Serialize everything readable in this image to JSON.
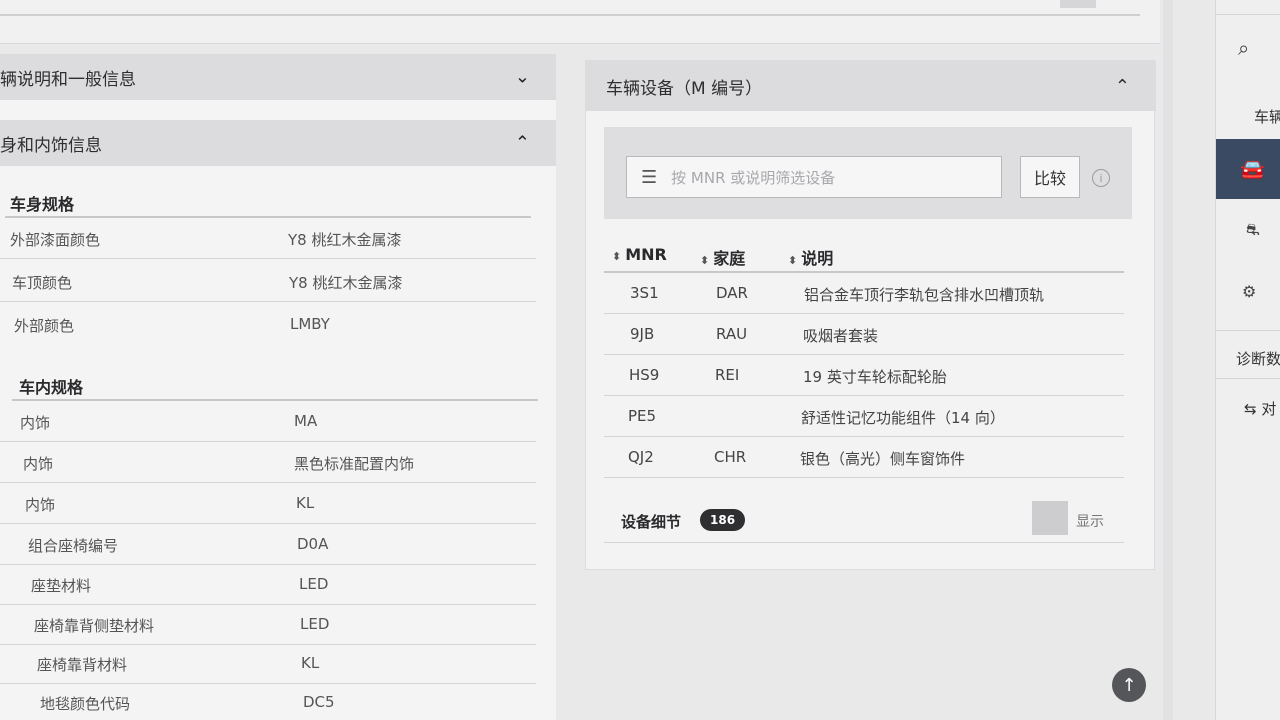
{
  "left": {
    "acc1_title": "辆说明和一般信息",
    "acc2_title": "身和内饰信息",
    "body_spec_title": "车身规格",
    "body_rows": [
      {
        "k": "外部漆面颜色",
        "v": "Y8 桃红木金属漆"
      },
      {
        "k": "车顶颜色",
        "v": "Y8 桃红木金属漆"
      },
      {
        "k": "外部颜色",
        "v": "LMBY"
      }
    ],
    "interior_spec_title": "车内规格",
    "interior_rows": [
      {
        "k": "内饰",
        "v": "MA"
      },
      {
        "k": "内饰",
        "v": "黑色标准配置内饰"
      },
      {
        "k": "内饰",
        "v": "KL"
      },
      {
        "k": "组合座椅编号",
        "v": "D0A"
      },
      {
        "k": "座垫材料",
        "v": "LED"
      },
      {
        "k": "座椅靠背侧垫材料",
        "v": "LED"
      },
      {
        "k": "座椅靠背材料",
        "v": "KL"
      },
      {
        "k": "地毯颜色代码",
        "v": "DC5"
      }
    ]
  },
  "right": {
    "title": "车辆设备（M 编号）",
    "filter_placeholder": "按 MNR 或说明筛选设备",
    "compare_label": "比较",
    "columns": [
      "MNR",
      "家庭",
      "说明"
    ],
    "rows": [
      {
        "mnr": "3S1",
        "family": "DAR",
        "desc": "铝合金车顶行李轨包含排水凹槽顶轨"
      },
      {
        "mnr": "9JB",
        "family": "RAU",
        "desc": "吸烟者套装"
      },
      {
        "mnr": "HS9",
        "family": "REI",
        "desc": "19 英寸车轮标配轮胎"
      },
      {
        "mnr": "PE5",
        "family": "",
        "desc": "舒适性记忆功能组件（14 向）"
      },
      {
        "mnr": "QJ2",
        "family": "CHR",
        "desc": "银色（高光）侧车窗饰件"
      }
    ],
    "detail_label": "设备细节",
    "detail_count": "186",
    "show_label": "显示"
  },
  "sidebar": {
    "item_top": "车辆",
    "item_diag": "诊断数",
    "item_compare": "对"
  },
  "icons": {
    "search": "search-icon",
    "car": "car-icon",
    "filter": "filter-icon",
    "info": "info-icon",
    "up": "arrow-up-icon"
  }
}
